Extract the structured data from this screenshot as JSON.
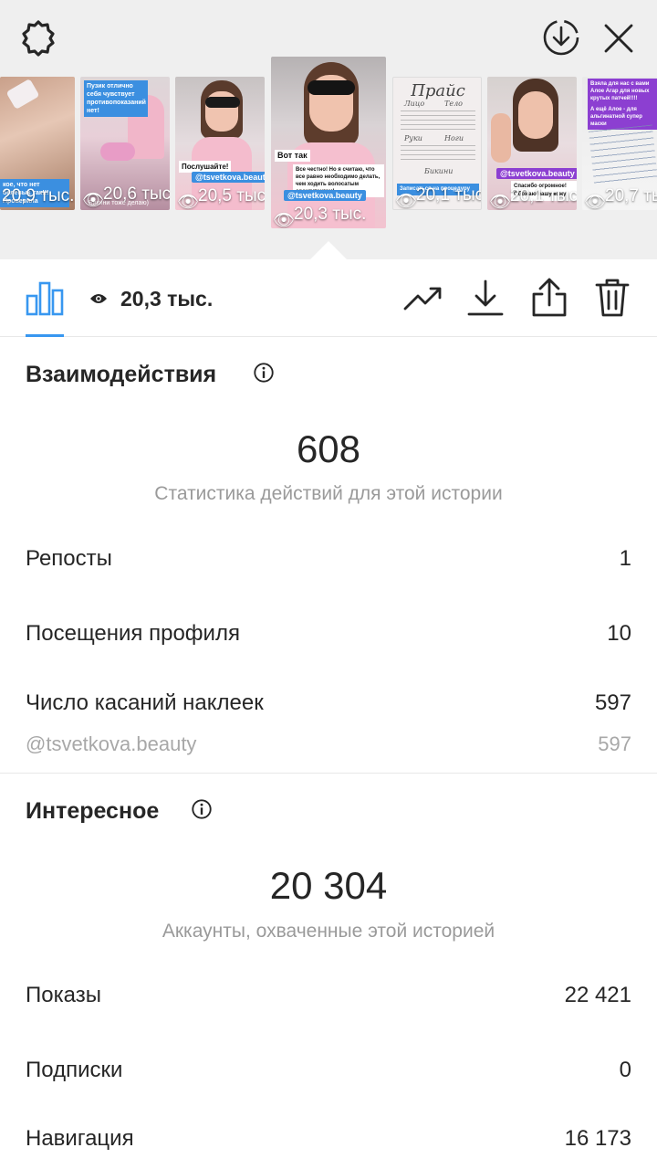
{
  "header": {
    "icons": [
      "settings-icon",
      "download-circle-icon",
      "close-icon"
    ]
  },
  "stories": [
    {
      "views": "20,9 тыс.",
      "caption": "кое, что нет белевых так!!! Проверила",
      "tag": ""
    },
    {
      "views": "20,6 тыс.",
      "caption": "Пузик отлично себя чувствует противопоказаний нет!",
      "tag": "",
      "note": "Бикини тоже делаю)"
    },
    {
      "views": "20,5 тыс.",
      "caption": "Послушайте!",
      "tag": "@tsvetkova.beauty"
    },
    {
      "views": "20,3 тыс.",
      "caption": "Вот так",
      "caption2": "Все честно! Но я считаю, что все равно необходимо делать, чем ходить волосатым орангутангом!",
      "tag": "@tsvetkova.beauty",
      "selected": true
    },
    {
      "views": "20,1 тыс.",
      "price_title": "Прайс",
      "price_cols": [
        "Лицо",
        "Тело",
        "Руки",
        "Ноги",
        "Бикини"
      ],
      "caption": "Записаться на процедуру"
    },
    {
      "views": "20,1 тыс.",
      "caption": "Спасибо огромное! Обожаю вашу кожу!",
      "tag": "@tsvetkova.beauty"
    },
    {
      "views": "20,7 тыс.",
      "caption": "Взяла для нас с вами Алое Агар для новых крутых патчей!!!!",
      "caption2": "А ещё Алое - для альгинатной супер маски"
    }
  ],
  "toolbar": {
    "views": "20,3 тыс.",
    "icons": [
      "bar-chart-icon",
      "eye-icon",
      "trending-icon",
      "download-icon",
      "share-icon",
      "trash-icon"
    ]
  },
  "interactions": {
    "title": "Взаимодействия",
    "total": "608",
    "subtitle": "Статистика действий для этой истории",
    "rows": [
      {
        "label": "Репосты",
        "value": "1"
      },
      {
        "label": "Посещения профиля",
        "value": "10"
      },
      {
        "label": "Число касаний наклеек",
        "value": "597"
      },
      {
        "label": "@tsvetkova.beauty",
        "value": "597"
      }
    ]
  },
  "discovery": {
    "title": "Интересное",
    "total": "20 304",
    "subtitle": "Аккаунты, охваченные этой историей",
    "rows": [
      {
        "label": "Показы",
        "value": "22 421"
      },
      {
        "label": "Подписки",
        "value": "0"
      },
      {
        "label": "Навигация",
        "value": "16 173"
      }
    ]
  },
  "colors": {
    "accent": "#3897f0",
    "text": "#262626",
    "muted": "#9a9a9a",
    "top_bg": "#efefef"
  }
}
